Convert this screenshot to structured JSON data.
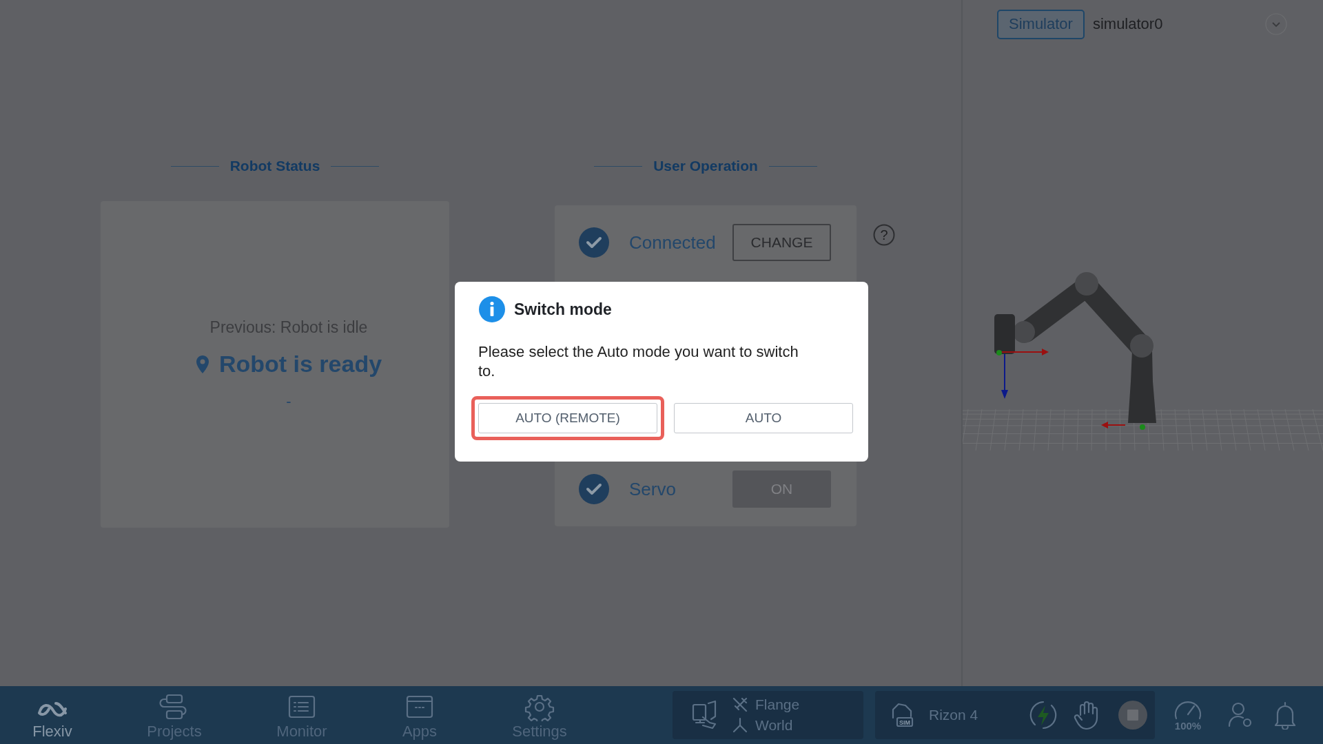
{
  "robot_status": {
    "heading": "Robot Status",
    "previous": "Previous: Robot is idle",
    "status": "Robot is ready",
    "detail": "-"
  },
  "user_operation": {
    "heading": "User Operation",
    "rows": [
      {
        "label": "Connected",
        "checked": true,
        "button": "CHANGE",
        "disabled": false,
        "help": "?"
      },
      {
        "label": "Servo",
        "checked": true,
        "button": "ON",
        "disabled": true
      }
    ]
  },
  "dialog": {
    "title": "Switch mode",
    "message": "Please select the Auto mode you want to switch to.",
    "buttons": [
      {
        "label": "AUTO (REMOTE)",
        "highlighted": true
      },
      {
        "label": "AUTO",
        "highlighted": false
      }
    ]
  },
  "viewer": {
    "mode_tag": "Simulator",
    "device": "simulator0"
  },
  "nav": [
    {
      "label": "Flexiv",
      "selected": true
    },
    {
      "label": "Projects",
      "selected": false
    },
    {
      "label": "Monitor",
      "selected": false
    },
    {
      "label": "Apps",
      "selected": false
    },
    {
      "label": "Settings",
      "selected": false
    }
  ],
  "status_bar": {
    "frames": [
      "Flange",
      "World"
    ],
    "robot": "Rizon 4",
    "robot_badge": "SIM",
    "speed": "100%"
  }
}
